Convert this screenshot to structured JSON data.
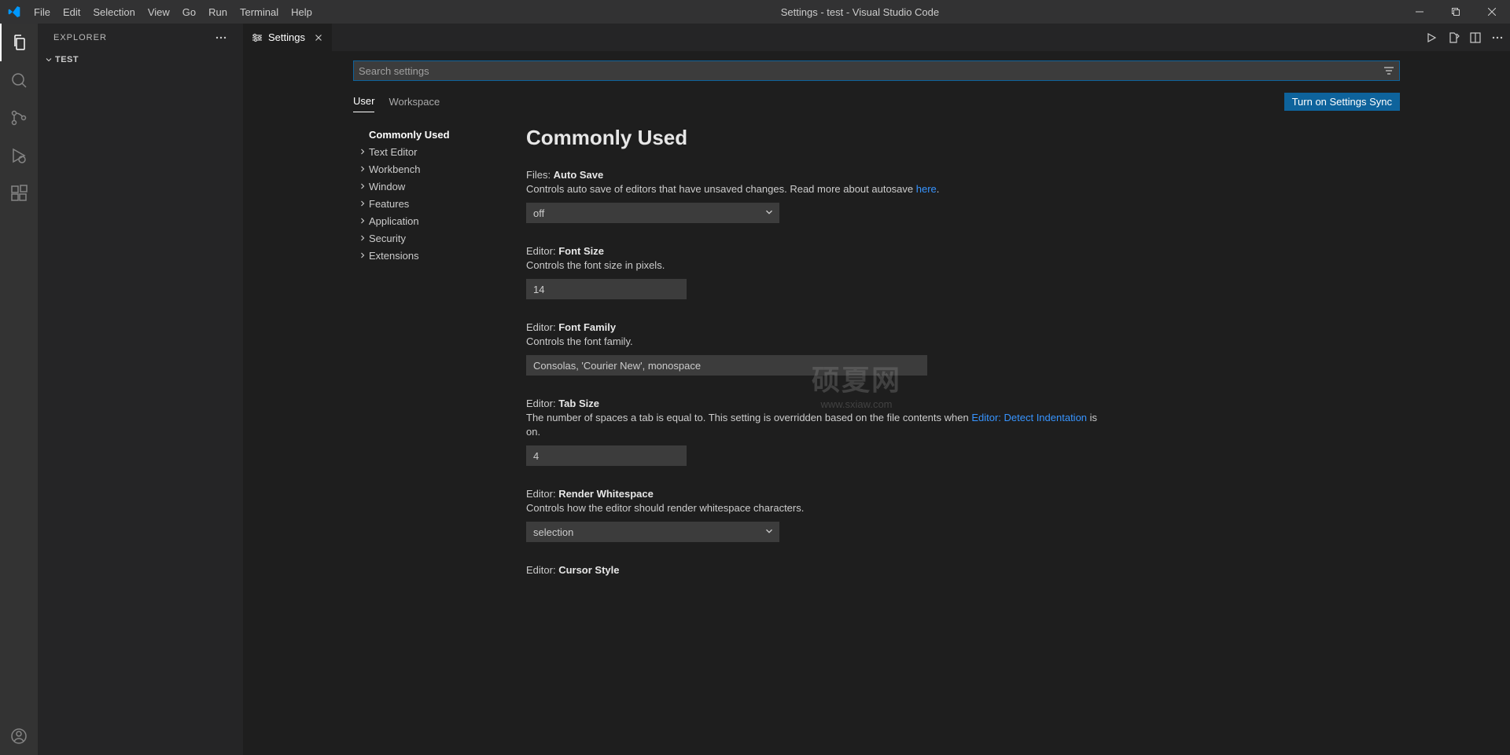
{
  "titleBar": {
    "menus": [
      "File",
      "Edit",
      "Selection",
      "View",
      "Go",
      "Run",
      "Terminal",
      "Help"
    ],
    "title": "Settings - test - Visual Studio Code"
  },
  "sidebar": {
    "header": "EXPLORER",
    "folder": "TEST"
  },
  "tab": {
    "label": "Settings"
  },
  "settings": {
    "searchPlaceholder": "Search settings",
    "tabs": {
      "user": "User",
      "workspace": "Workspace"
    },
    "syncButton": "Turn on Settings Sync",
    "toc": [
      "Commonly Used",
      "Text Editor",
      "Workbench",
      "Window",
      "Features",
      "Application",
      "Security",
      "Extensions"
    ],
    "heading": "Commonly Used",
    "items": {
      "autoSave": {
        "prefix": "Files: ",
        "name": "Auto Save",
        "descA": "Controls auto save of editors that have unsaved changes. Read more about autosave ",
        "link": "here",
        "descB": ".",
        "value": "off"
      },
      "fontSize": {
        "prefix": "Editor: ",
        "name": "Font Size",
        "desc": "Controls the font size in pixels.",
        "value": "14"
      },
      "fontFamily": {
        "prefix": "Editor: ",
        "name": "Font Family",
        "desc": "Controls the font family.",
        "value": "Consolas, 'Courier New', monospace"
      },
      "tabSize": {
        "prefix": "Editor: ",
        "name": "Tab Size",
        "descA": "The number of spaces a tab is equal to. This setting is overridden based on the file contents when ",
        "link": "Editor: Detect Indentation",
        "descB": " is on.",
        "value": "4"
      },
      "renderWhitespace": {
        "prefix": "Editor: ",
        "name": "Render Whitespace",
        "desc": "Controls how the editor should render whitespace characters.",
        "value": "selection"
      },
      "cursorStyle": {
        "prefix": "Editor: ",
        "name": "Cursor Style"
      }
    }
  },
  "watermark": {
    "big": "硕夏网",
    "small": "www.sxiaw.com"
  }
}
